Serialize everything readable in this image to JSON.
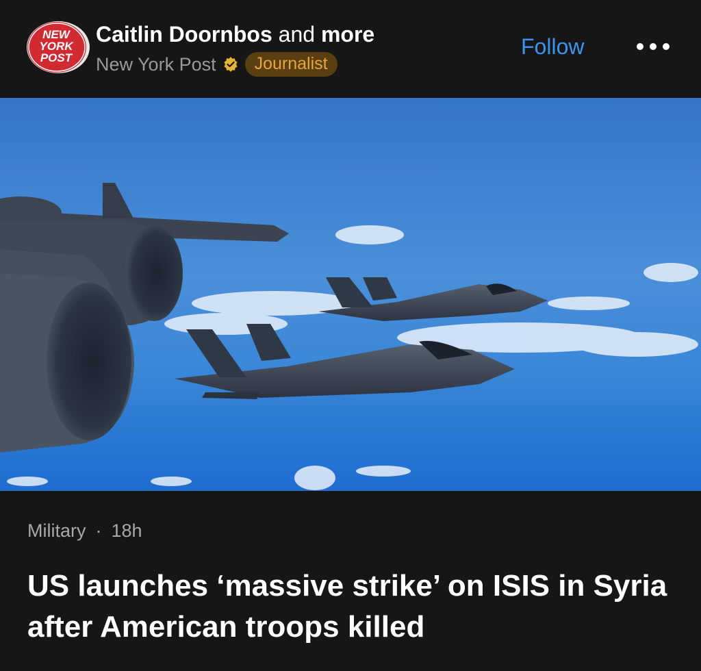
{
  "post": {
    "logo_text": [
      "NEW",
      "YORK",
      "POST"
    ],
    "author_primary": "Caitlin Doornbos",
    "author_joiner": "and",
    "author_more": "more",
    "publication": "New York Post",
    "badge": "Journalist",
    "follow_label": "Follow",
    "more_icon": "ellipsis-icon",
    "verified_icon": "verified-badge-icon"
  },
  "article": {
    "category": "Military",
    "separator": "·",
    "age": "18h",
    "headline": "US launches ‘massive strike’ on ISIS in Syria after American troops killed",
    "image_description_icon": "photo"
  },
  "colors": {
    "background": "#161616",
    "follow": "#3b93f2",
    "badge_bg": "#5a3f12",
    "badge_text": "#e6a63c",
    "sky_top": "#2e6fc0",
    "sky_bottom": "#1f6ad0"
  }
}
